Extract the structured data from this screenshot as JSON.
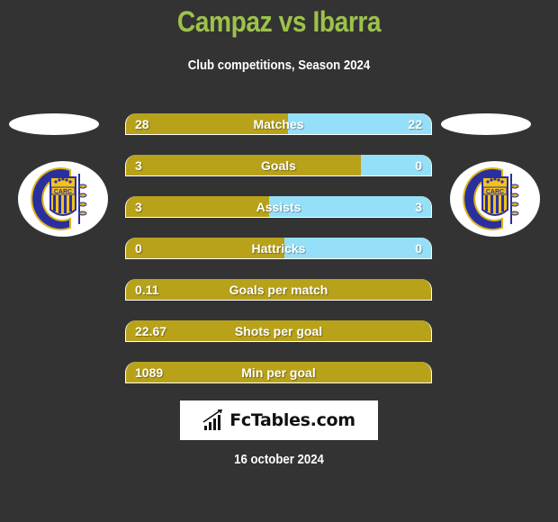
{
  "header": {
    "title": "Campaz vs Ibarra",
    "subtitle": "Club competitions, Season 2024"
  },
  "players": {
    "left": {
      "name": "Campaz",
      "logo": "rosario-central-crest-icon"
    },
    "right": {
      "name": "Ibarra",
      "logo": "rosario-central-crest-icon"
    }
  },
  "colors": {
    "left": "#b8a21a",
    "right": "#95e0f8",
    "title": "#9dc24a",
    "background": "#333333"
  },
  "stats": [
    {
      "label": "Matches",
      "left": "28",
      "right": "22",
      "left_share": 0.53
    },
    {
      "label": "Goals",
      "left": "3",
      "right": "0",
      "left_share": 0.77
    },
    {
      "label": "Assists",
      "left": "3",
      "right": "3",
      "left_share": 0.47
    },
    {
      "label": "Hattricks",
      "left": "0",
      "right": "0",
      "left_share": 0.52
    },
    {
      "label": "Goals per match",
      "left": "0.11",
      "right": "",
      "left_share": 1.0
    },
    {
      "label": "Shots per goal",
      "left": "22.67",
      "right": "",
      "left_share": 1.0
    },
    {
      "label": "Min per goal",
      "left": "1089",
      "right": "",
      "left_share": 1.0
    }
  ],
  "brand": {
    "name": "FcTables.com",
    "icon": "bar-chart-icon"
  },
  "date": "16 october 2024"
}
